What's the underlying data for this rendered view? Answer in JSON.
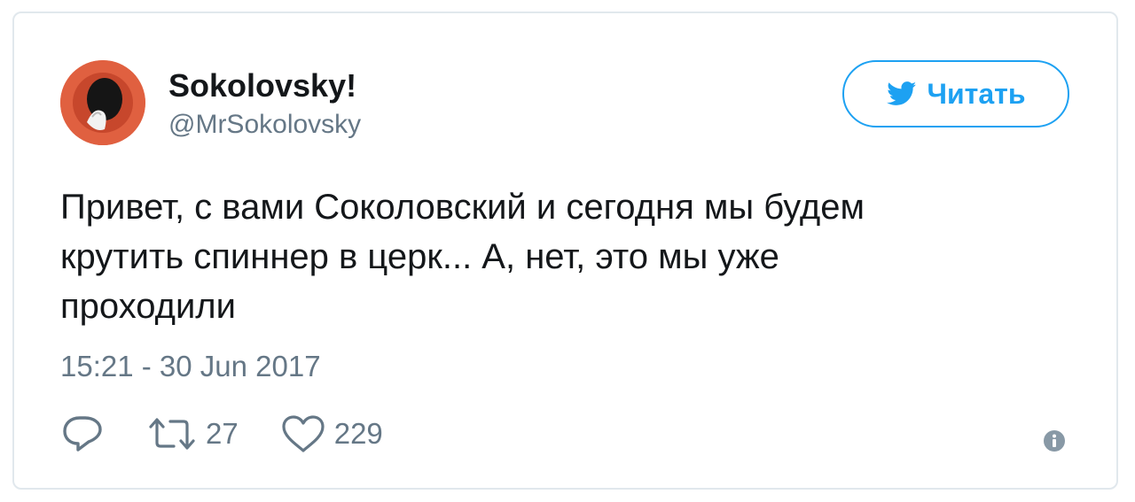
{
  "author": {
    "name": "Sokolovsky!",
    "handle": "@MrSokolovsky"
  },
  "follow_button": {
    "label": "Читать",
    "icon": "twitter-bird-icon"
  },
  "tweet": {
    "lines": [
      "Привет, с вами Соколовский и сегодня мы будем",
      "крутить спиннер в церк... А, нет, это мы уже",
      "проходили"
    ],
    "timestamp": "15:21 - 30 Jun 2017"
  },
  "actions": {
    "reply": {
      "icon": "reply-icon"
    },
    "retweet": {
      "icon": "retweet-icon",
      "count": "27"
    },
    "like": {
      "icon": "heart-icon",
      "count": "229"
    },
    "info": {
      "icon": "info-icon"
    }
  },
  "colors": {
    "accent": "#1da1f2",
    "text": "#14171a",
    "secondary": "#657786",
    "border": "#e1e8ed"
  }
}
